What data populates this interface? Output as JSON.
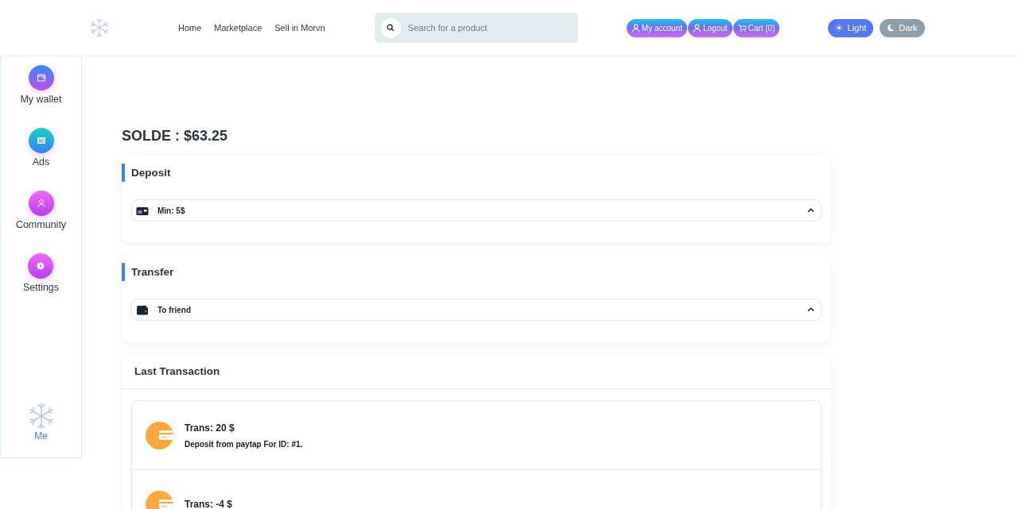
{
  "header": {
    "nav": [
      "Home",
      "Marketplace",
      "Sell in Morvn"
    ],
    "search": {
      "placeholder": "Search for a product"
    },
    "account_buttons": [
      {
        "kind": "user",
        "label": "My account"
      },
      {
        "kind": "user",
        "label": "Logout"
      },
      {
        "kind": "cart",
        "label": "Cart (0)"
      }
    ],
    "theme": [
      {
        "kind": "sun",
        "label": "Light",
        "selected": true
      },
      {
        "kind": "moon",
        "label": "Dark",
        "selected": false
      }
    ]
  },
  "sidebar": {
    "items": [
      {
        "kind": "wallet",
        "label": "My wallet"
      },
      {
        "kind": "ad",
        "label": "Ads"
      },
      {
        "kind": "user",
        "label": "Community"
      },
      {
        "kind": "gear",
        "label": "Settings"
      }
    ],
    "profile": {
      "label": "Me"
    }
  },
  "balance": "SOLDE : $63.25",
  "sections": [
    {
      "title": "Deposit",
      "option": {
        "kind": "card",
        "label": "Min: 5$",
        "expanded": true
      }
    },
    {
      "title": "Transfer",
      "option": {
        "kind": "wallet",
        "label": "To friend",
        "expanded": true
      }
    }
  ],
  "transactions": {
    "title": "Last Transaction",
    "items": [
      {
        "amount": "Trans: 20 $",
        "description": "Deposit from paytap For ID: #1."
      },
      {
        "amount": "Trans: -4 $"
      }
    ]
  }
}
